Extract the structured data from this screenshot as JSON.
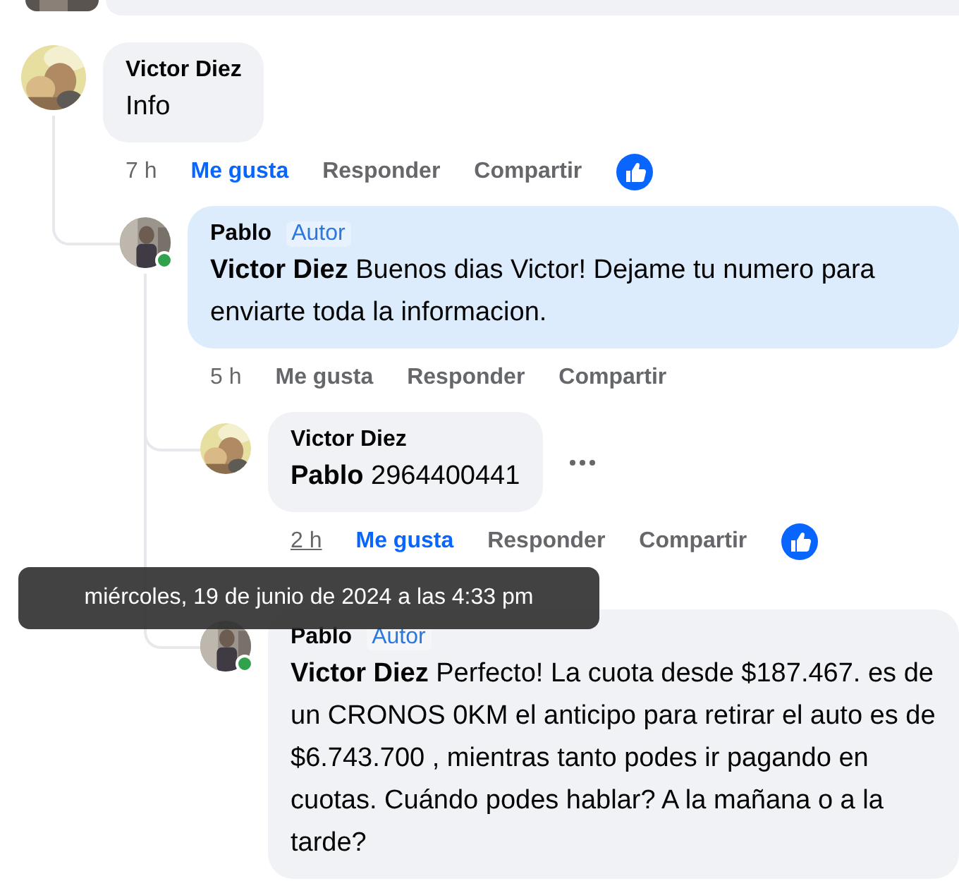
{
  "comments": [
    {
      "author": "Victor Diez",
      "body": "Info",
      "highlighted": false,
      "online": false,
      "more_button": false,
      "actions": {
        "time": "7 h",
        "time_hovered": false,
        "like": "Me gusta",
        "liked": true,
        "reply": "Responder",
        "share": "Compartir",
        "reacted": true
      },
      "children": [
        {
          "author": "Pablo",
          "badge": "Autor",
          "body": "**Victor Diez** Buenos dias Victor! Dejame tu numero para enviarte toda la informacion.",
          "highlighted": true,
          "online": true,
          "more_button": false,
          "actions": {
            "time": "5 h",
            "time_hovered": false,
            "like": "Me gusta",
            "liked": false,
            "reply": "Responder",
            "share": "Compartir",
            "reacted": false
          },
          "children": [
            {
              "author": "Victor Diez",
              "body": "**Pablo** 2964400441",
              "highlighted": false,
              "online": false,
              "more_button": true,
              "actions": {
                "time": "2 h",
                "time_hovered": true,
                "like": "Me gusta",
                "liked": true,
                "reply": "Responder",
                "share": "Compartir",
                "reacted": true
              }
            },
            {
              "author": "Pablo",
              "badge": "Autor",
              "body": "**Victor Diez** Perfecto! La cuota desde $187.467. es de un CRONOS 0KM el anticipo para retirar el auto es de $6.743.700 , mientras tanto podes ir pagando en cuotas. Cuándo podes hablar? A la mañana o a la tarde?",
              "highlighted": false,
              "online": true,
              "more_button": false
            }
          ]
        }
      ]
    }
  ],
  "tooltip": "miércoles, 19 de junio de 2024 a las 4:33 pm"
}
